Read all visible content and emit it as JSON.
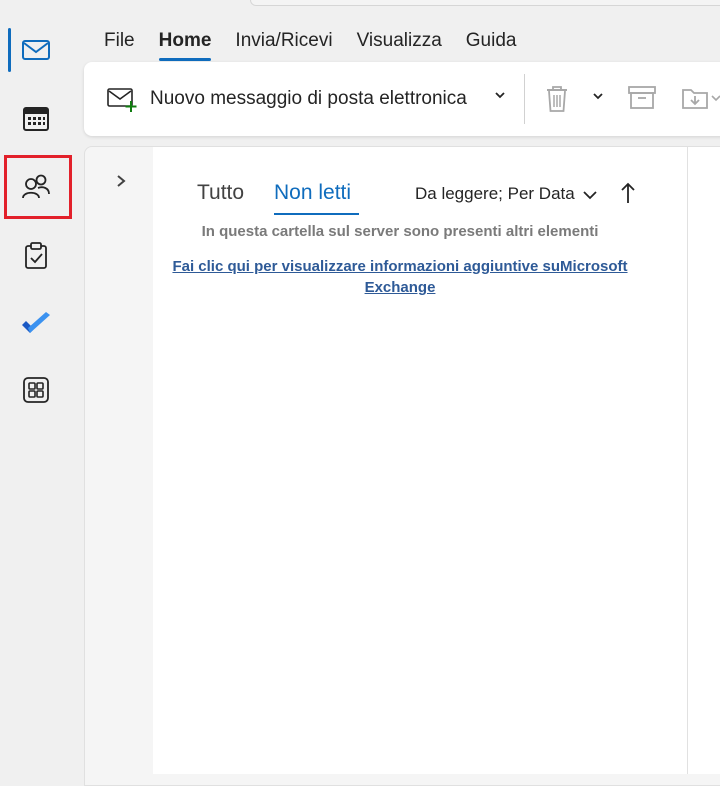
{
  "menu": {
    "tabs": [
      {
        "label": "File"
      },
      {
        "label": "Home"
      },
      {
        "label": "Invia/Ricevi"
      },
      {
        "label": "Visualizza"
      },
      {
        "label": "Guida"
      }
    ]
  },
  "rail": {
    "items": [
      "mail-icon",
      "calendar-icon",
      "people-icon",
      "tasks-icon",
      "todo-icon",
      "apps-icon"
    ]
  },
  "ribbon": {
    "new_mail_label": "Nuovo messaggio di posta elettronica"
  },
  "list": {
    "filters": [
      {
        "label": "Tutto"
      },
      {
        "label": "Non letti"
      }
    ],
    "sort_label": "Da leggere; Per Data",
    "info_text": "In questa cartella sul server sono presenti altri elementi",
    "info_link": "Fai clic qui per visualizzare informazioni aggiuntive suMicrosoft Exchange"
  },
  "colors": {
    "accent": "#0f6cbd",
    "highlight": "#e2202a",
    "link": "#2e5a97"
  }
}
